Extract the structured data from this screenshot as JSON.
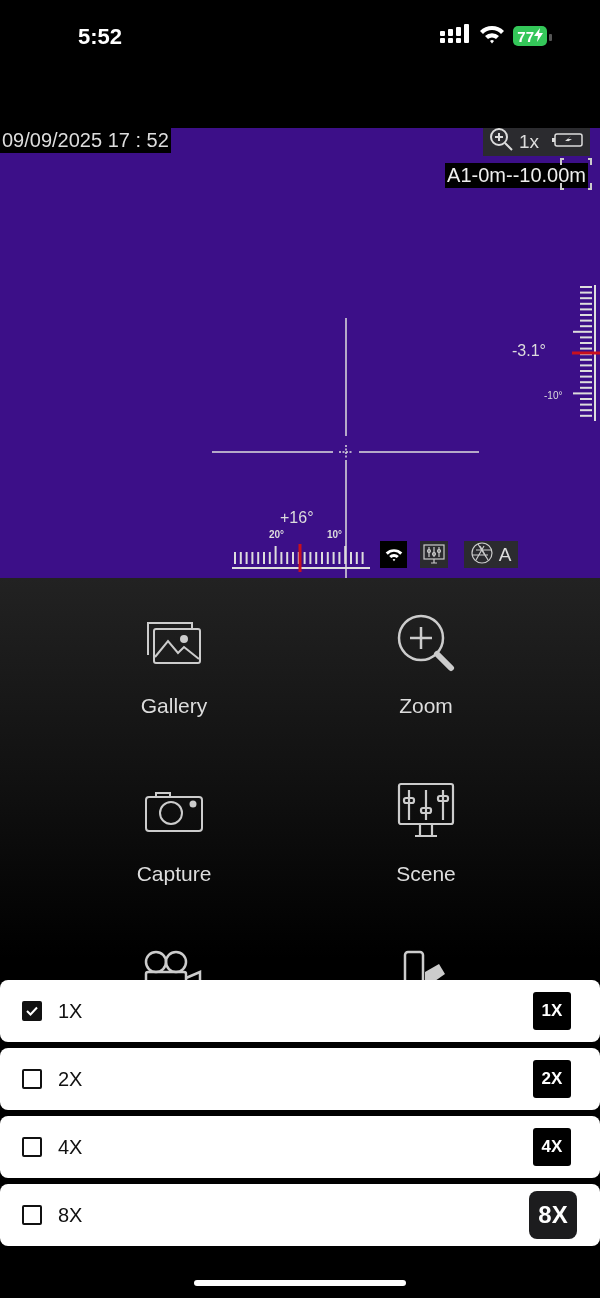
{
  "status_bar": {
    "time": "5:52",
    "battery": "77"
  },
  "viewer": {
    "timestamp": "09/09/2025 17 : 52",
    "zoom_readout": "1x",
    "measurement": "A1-0m--10.00m",
    "pitch": "-3.1°",
    "pitch_tick": "-10°",
    "roll": "+16°",
    "roll_ticks": [
      "20°",
      "10°"
    ],
    "exposure_mode": "A"
  },
  "menu": {
    "items": [
      {
        "kind": "gallery",
        "label": "Gallery"
      },
      {
        "kind": "zoom",
        "label": "Zoom"
      },
      {
        "kind": "capture",
        "label": "Capture"
      },
      {
        "kind": "scene",
        "label": "Scene"
      },
      {
        "kind": "record"
      },
      {
        "kind": "palette"
      }
    ]
  },
  "zoom_options": [
    {
      "label": "1X",
      "badge": "1X",
      "checked": true,
      "pressed": false
    },
    {
      "label": "2X",
      "badge": "2X",
      "checked": false,
      "pressed": false
    },
    {
      "label": "4X",
      "badge": "4X",
      "checked": false,
      "pressed": false
    },
    {
      "label": "8X",
      "badge": "8X",
      "checked": false,
      "pressed": true
    }
  ]
}
